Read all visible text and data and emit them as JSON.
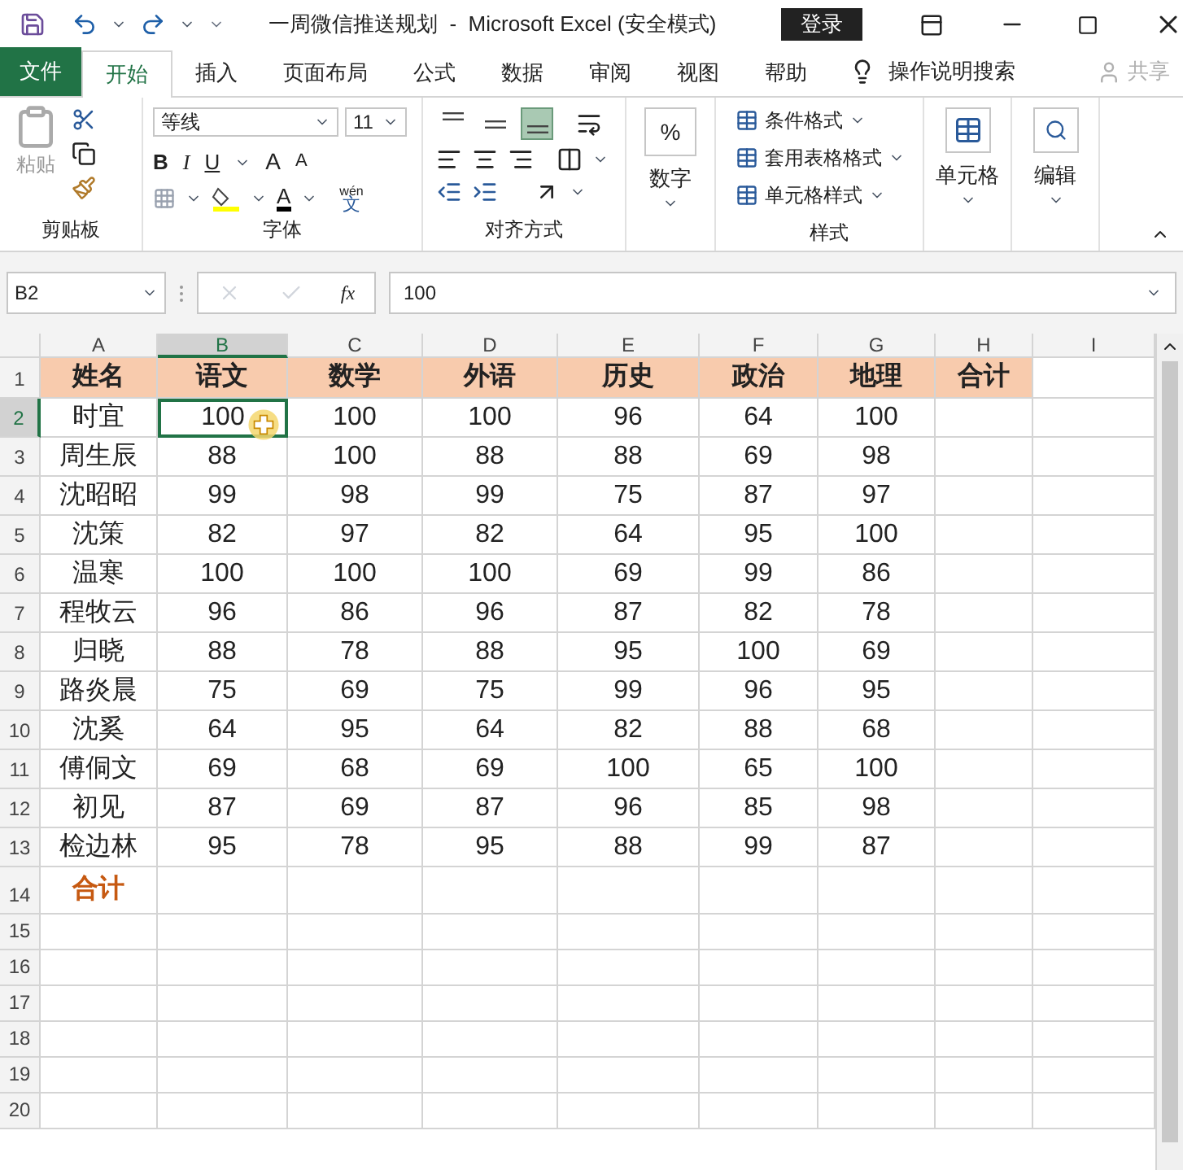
{
  "title_bar": {
    "title": "一周微信推送规划  -  Microsoft Excel (安全模式)",
    "login_button": "登录"
  },
  "tabs": [
    {
      "label": "文件",
      "kind": "file",
      "selected": false
    },
    {
      "label": "开始",
      "kind": "tab",
      "selected": true
    },
    {
      "label": "插入",
      "kind": "tab",
      "selected": false
    },
    {
      "label": "页面布局",
      "kind": "tab",
      "selected": false
    },
    {
      "label": "公式",
      "kind": "tab",
      "selected": false
    },
    {
      "label": "数据",
      "kind": "tab",
      "selected": false
    },
    {
      "label": "审阅",
      "kind": "tab",
      "selected": false
    },
    {
      "label": "视图",
      "kind": "tab",
      "selected": false
    },
    {
      "label": "帮助",
      "kind": "tab",
      "selected": false
    }
  ],
  "tell_me": "操作说明搜索",
  "share": {
    "label": "共享",
    "disabled": true
  },
  "ribbon": {
    "clipboard": {
      "paste": "粘贴",
      "label": "剪贴板"
    },
    "font": {
      "font_name": "等线",
      "font_size": "11",
      "bold": "B",
      "italic": "I",
      "underline": "U",
      "grow": "A",
      "shrink": "A",
      "font_color": "A",
      "phonetic_top": "wén",
      "phonetic_bottom": "文",
      "label": "字体"
    },
    "alignment": {
      "vertical": [
        {
          "kind": "top",
          "selected": false
        },
        {
          "kind": "middle",
          "selected": false
        },
        {
          "kind": "bottom",
          "selected": true
        }
      ],
      "label": "对齐方式"
    },
    "number": {
      "symbol": "%",
      "label": "数字"
    },
    "styles": {
      "items": [
        "条件格式",
        "套用表格格式",
        "单元格样式"
      ],
      "label": "样式"
    },
    "cells": {
      "label": "单元格"
    },
    "editing": {
      "label": "编辑"
    }
  },
  "formula_bar": {
    "name_box": "B2",
    "fx": "fx",
    "value": "100"
  },
  "columns": [
    {
      "letter": "A",
      "selected": false
    },
    {
      "letter": "B",
      "selected": true
    },
    {
      "letter": "C",
      "selected": false
    },
    {
      "letter": "D",
      "selected": false
    },
    {
      "letter": "E",
      "selected": false
    },
    {
      "letter": "F",
      "selected": false
    },
    {
      "letter": "G",
      "selected": false
    },
    {
      "letter": "H",
      "selected": false
    },
    {
      "letter": "I",
      "selected": false
    }
  ],
  "rows": [
    {
      "number": "1",
      "kind": "header",
      "selected": false,
      "cells": [
        "姓名",
        "语文",
        "数学",
        "外语",
        "历史",
        "政治",
        "地理",
        "合计"
      ]
    },
    {
      "number": "2",
      "kind": "data",
      "selected": true,
      "cells": [
        "时宜",
        "100",
        "100",
        "100",
        "96",
        "64",
        "100"
      ]
    },
    {
      "number": "3",
      "kind": "data",
      "selected": false,
      "cells": [
        "周生辰",
        "88",
        "100",
        "88",
        "88",
        "69",
        "98"
      ]
    },
    {
      "number": "4",
      "kind": "data",
      "selected": false,
      "cells": [
        "沈昭昭",
        "99",
        "98",
        "99",
        "75",
        "87",
        "97"
      ]
    },
    {
      "number": "5",
      "kind": "data",
      "selected": false,
      "cells": [
        "沈策",
        "82",
        "97",
        "82",
        "64",
        "95",
        "100"
      ]
    },
    {
      "number": "6",
      "kind": "data",
      "selected": false,
      "cells": [
        "温寒",
        "100",
        "100",
        "100",
        "69",
        "99",
        "86"
      ]
    },
    {
      "number": "7",
      "kind": "data",
      "selected": false,
      "cells": [
        "程牧云",
        "96",
        "86",
        "96",
        "87",
        "82",
        "78"
      ]
    },
    {
      "number": "8",
      "kind": "data",
      "selected": false,
      "cells": [
        "归晓",
        "88",
        "78",
        "88",
        "95",
        "100",
        "69"
      ]
    },
    {
      "number": "9",
      "kind": "data",
      "selected": false,
      "cells": [
        "路炎晨",
        "75",
        "69",
        "75",
        "99",
        "96",
        "95"
      ]
    },
    {
      "number": "10",
      "kind": "data",
      "selected": false,
      "cells": [
        "沈奚",
        "64",
        "95",
        "64",
        "82",
        "88",
        "68"
      ]
    },
    {
      "number": "11",
      "kind": "data",
      "selected": false,
      "cells": [
        "傅侗文",
        "69",
        "68",
        "69",
        "100",
        "65",
        "100"
      ]
    },
    {
      "number": "12",
      "kind": "data",
      "selected": false,
      "cells": [
        "初见",
        "87",
        "69",
        "87",
        "96",
        "85",
        "98"
      ]
    },
    {
      "number": "13",
      "kind": "data",
      "selected": false,
      "cells": [
        "检边林",
        "95",
        "78",
        "95",
        "88",
        "99",
        "87"
      ]
    },
    {
      "number": "14",
      "kind": "total",
      "selected": false,
      "cells": [
        "合计"
      ]
    },
    {
      "number": "15",
      "kind": "empty",
      "selected": false
    },
    {
      "number": "16",
      "kind": "empty",
      "selected": false
    },
    {
      "number": "17",
      "kind": "empty",
      "selected": false
    },
    {
      "number": "18",
      "kind": "empty",
      "selected": false
    },
    {
      "number": "19",
      "kind": "empty",
      "selected": false
    },
    {
      "number": "20",
      "kind": "empty",
      "selected": false
    }
  ]
}
